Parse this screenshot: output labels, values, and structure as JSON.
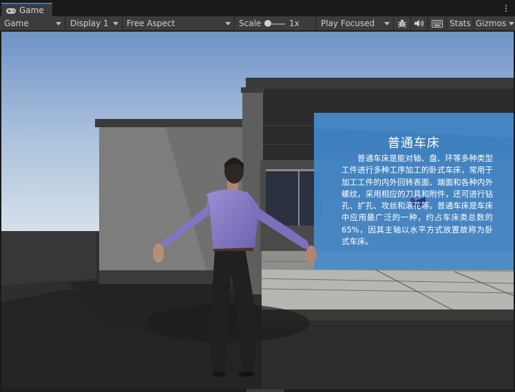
{
  "window": {
    "tab_label": "Game",
    "tab_icon": "gamepad-icon"
  },
  "toolbar": {
    "view_mode": "Game",
    "display": "Display 1",
    "aspect": "Free Aspect",
    "scale_label": "Scale",
    "scale_value": "1x",
    "play_mode": "Play Focused",
    "stats_label": "Stats",
    "gizmos_label": "Gizmos",
    "icons": [
      "bug-icon",
      "speaker-icon",
      "keyboard-icon"
    ]
  },
  "scene": {
    "panel_title": "普通车床",
    "panel_body": "普通车床是能对轴、盘、环等多种类型工件进行多种工序加工的卧式车床，常用于加工工件的内外回转表面、端面和各种内外螺纹，采用相应的刀具和附件，还可进行钻孔、扩孔、攻丝和滚花等。普通车床是车床中应用最广泛的一种，约占车床类总数的65%，因其主轴以水平方式放置故称为卧式车床。",
    "colors": {
      "sky_top": "#6f93c6",
      "sky_bottom": "#d2dde9",
      "panel": "#3f86c9",
      "shirt": "#8578c4",
      "pants": "#202020"
    }
  }
}
